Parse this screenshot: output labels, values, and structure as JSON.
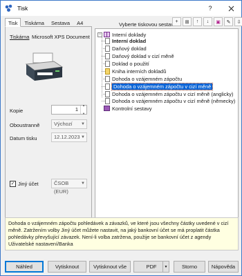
{
  "window": {
    "title": "Tisk",
    "help_label": "?",
    "close_label": "✕"
  },
  "tabs": [
    {
      "label": "Tisk",
      "active": true
    },
    {
      "label": "Tiskárna"
    },
    {
      "label": "Sestava"
    },
    {
      "label": "A4"
    }
  ],
  "printer": {
    "label": "Tiskárna",
    "name": "Microsoft XPS Document"
  },
  "form": {
    "copies_label": "Kopie",
    "copies_value": "1",
    "duplex_label": "Oboustranně",
    "duplex_value": "Výchozí",
    "date_label": "Datum tisku",
    "date_value": "12.12.2023",
    "other_account_label": "Jiný účet",
    "other_account_checked": true,
    "account_value": "ČSOB (EUR)"
  },
  "report_select": {
    "caption": "Vyberte tiskovou sestavu",
    "tree": {
      "group1": "Interní doklady",
      "items": [
        {
          "label": "Interní doklad",
          "bold": true
        },
        {
          "label": "Daňový doklad"
        },
        {
          "label": "Daňový doklad v cizí měně"
        },
        {
          "label": "Doklad o použití"
        },
        {
          "label": "Kniha interních dokladů",
          "yellow": true
        },
        {
          "label": "Dohoda o vzájemném zápočtu"
        },
        {
          "label": "Dohoda o vzájemném zápočtu v cizí měně",
          "selected": true
        },
        {
          "label": "Dohoda o vzájemném zápočtu v cizí měně (anglicky)"
        },
        {
          "label": "Dohoda o vzájemném zápočtu v cizí měně (německy)"
        }
      ],
      "group2": "Kontrolní sestavy"
    }
  },
  "description": "Dohoda o vzájemném zápočtu pohledávek a závazků, ve které jsou všechny částky uvedené v cizí měně. Zatržením volby Jiný účet můžete nastavit, na jaký bankovní účet se má proplatit částka pohledávky převyšující závazek. Není-li volba zatržena, použije se bankovní účet z agendy Uživatelské nastavení/Banka",
  "buttons": {
    "preview": "Náhled",
    "print": "Vytisknout",
    "print_all": "Vytisknout vše",
    "pdf": "PDF",
    "cancel": "Storno",
    "help": "Nápověda"
  }
}
